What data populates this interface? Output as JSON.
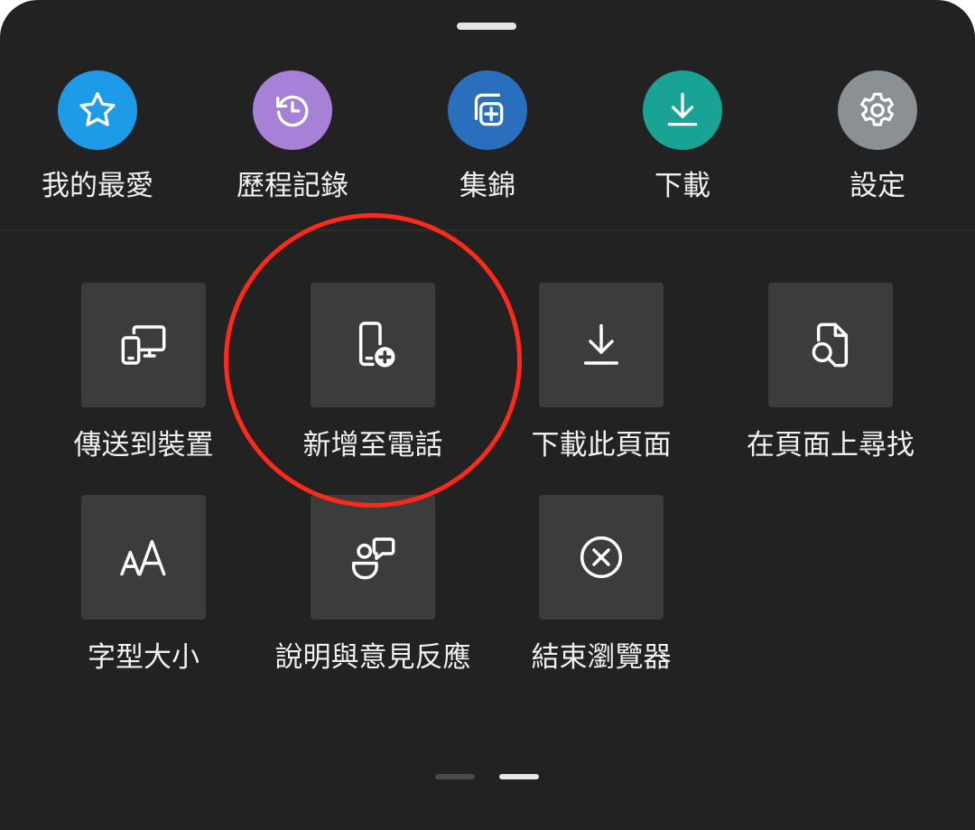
{
  "top_actions": [
    {
      "label": "我的最愛",
      "icon": "star-icon",
      "color": "#1e9be8"
    },
    {
      "label": "歷程記錄",
      "icon": "history-icon",
      "color": "#a781d8"
    },
    {
      "label": "集錦",
      "icon": "collections-icon",
      "color": "#2a6fbe"
    },
    {
      "label": "下載",
      "icon": "download-icon",
      "color": "#18a394"
    },
    {
      "label": "設定",
      "icon": "gear-icon",
      "color": "#8a9094"
    }
  ],
  "grid_actions": [
    {
      "label": "傳送到裝置",
      "icon": "send-to-device-icon"
    },
    {
      "label": "新增至電話",
      "icon": "add-to-phone-icon"
    },
    {
      "label": "下載此頁面",
      "icon": "download-page-icon"
    },
    {
      "label": "在頁面上尋找",
      "icon": "find-on-page-icon"
    },
    {
      "label": "字型大小",
      "icon": "font-size-icon"
    },
    {
      "label": "說明與意見反應",
      "icon": "help-feedback-icon"
    },
    {
      "label": "結束瀏覽器",
      "icon": "close-browser-icon"
    }
  ],
  "highlight_color": "#ff2a1a",
  "pager": {
    "pages": 2,
    "current": 2
  }
}
